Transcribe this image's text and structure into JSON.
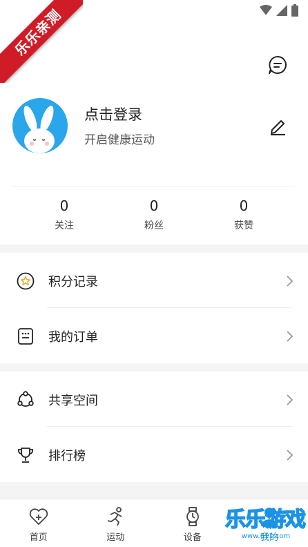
{
  "ribbon": {
    "text": "乐乐亲测"
  },
  "profile": {
    "title": "点击登录",
    "subtitle": "开启健康运动"
  },
  "stats": [
    {
      "count": "0",
      "label": "关注"
    },
    {
      "count": "0",
      "label": "粉丝"
    },
    {
      "count": "0",
      "label": "获赞"
    }
  ],
  "menu_group1": [
    {
      "label": "积分记录",
      "icon": "star-badge-icon"
    },
    {
      "label": "我的订单",
      "icon": "order-list-icon"
    }
  ],
  "menu_group2": [
    {
      "label": "共享空间",
      "icon": "share-space-icon"
    },
    {
      "label": "排行榜",
      "icon": "trophy-icon"
    }
  ],
  "tabs": [
    {
      "label": "首页",
      "icon": "heart-plus-icon"
    },
    {
      "label": "运动",
      "icon": "running-icon"
    },
    {
      "label": "设备",
      "icon": "watch-icon"
    },
    {
      "label": "我的",
      "icon": "user-icon",
      "active": true
    }
  ],
  "watermark": {
    "text": "乐乐游戏",
    "url": "www.611.com"
  },
  "colors": {
    "accent": "#1a93e6",
    "avatar_bg": "#2aa6ea",
    "ribbon": "#d01c26"
  }
}
